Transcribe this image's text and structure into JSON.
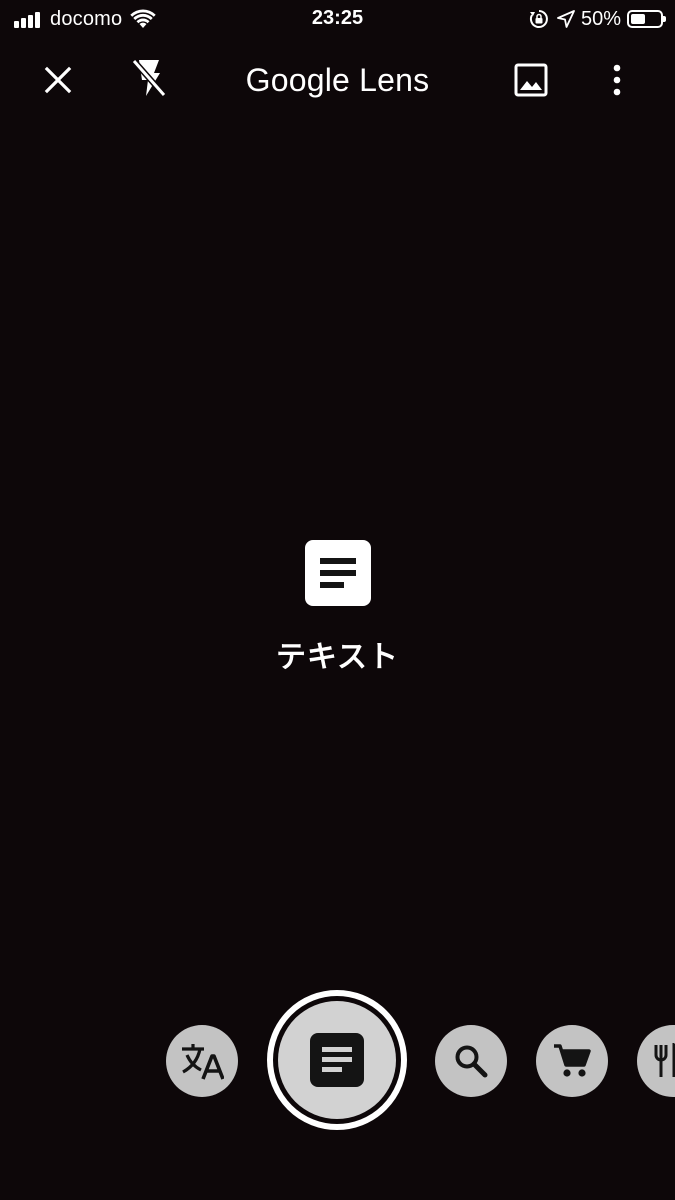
{
  "status_bar": {
    "carrier": "docomo",
    "time": "23:25",
    "battery": "50%",
    "battery_level": 0.5,
    "icons": [
      "signal-bars-icon",
      "wifi-icon",
      "orientation-lock-icon",
      "location-arrow-icon",
      "battery-icon"
    ]
  },
  "toolbar": {
    "title_part1": "Google",
    "title_part2": "Lens",
    "icons": [
      "close-icon",
      "flash-off-icon",
      "gallery-icon",
      "more-vert-icon"
    ]
  },
  "current_mode": {
    "label": "テキスト",
    "icon": "text-document-icon"
  },
  "modes": [
    {
      "name": "translate",
      "icon": "translate-icon"
    },
    {
      "name": "text",
      "icon": "text-document-icon",
      "selected": true
    },
    {
      "name": "search",
      "icon": "search-icon"
    },
    {
      "name": "shopping",
      "icon": "shopping-cart-icon"
    },
    {
      "name": "dining",
      "icon": "fork-knife-icon"
    }
  ],
  "colors": {
    "background": "#0d0709",
    "chip": "#c3c3c3",
    "shutter": "#d2d2d2",
    "icon_dark": "#141414"
  }
}
